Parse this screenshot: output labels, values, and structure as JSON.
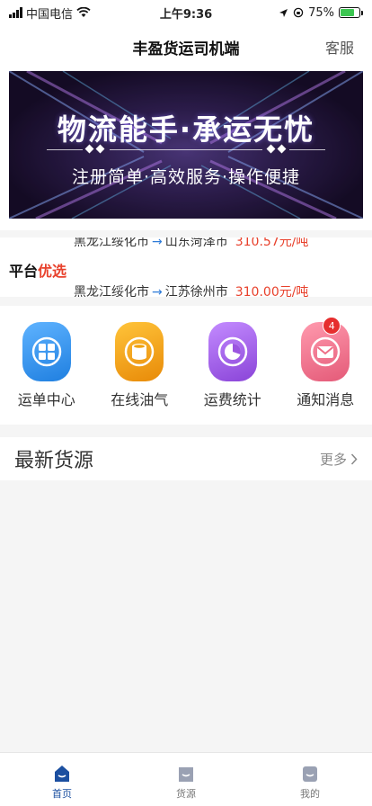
{
  "status_bar": {
    "carrier": "中国电信",
    "time": "上午9:36",
    "battery_percent": "75%",
    "battery_level": 0.75
  },
  "nav": {
    "title": "丰盈货运司机端",
    "service_label": "客服"
  },
  "banner": {
    "title": "物流能手·承运无忧",
    "subtitle": "注册简单·高效服务·操作便捷"
  },
  "ticker": {
    "brand_plain": "平台",
    "brand_highlight": "优选",
    "routes": [
      {
        "from": "黑龙江绥化市",
        "to": "山东菏泽市",
        "price": "310.57元/吨"
      },
      {
        "from": "黑龙江绥化市",
        "to": "江苏徐州市",
        "price": "310.00元/吨"
      }
    ]
  },
  "menu": {
    "items": [
      {
        "label": "运单中心",
        "icon": "grid-icon",
        "color": "#2b8be8"
      },
      {
        "label": "在线油气",
        "icon": "fuel-cylinder-icon",
        "color": "#f0a20c"
      },
      {
        "label": "运费统计",
        "icon": "pie-chart-icon",
        "color": "#9b55e0"
      },
      {
        "label": "通知消息",
        "icon": "mail-icon",
        "color": "#ee6e86",
        "badge": "4"
      }
    ]
  },
  "latest": {
    "title": "最新货源",
    "more_label": "更多"
  },
  "tabs": [
    {
      "label": "首页",
      "icon": "home-icon",
      "active": true
    },
    {
      "label": "货源",
      "icon": "cargo-icon",
      "active": false
    },
    {
      "label": "我的",
      "icon": "profile-icon",
      "active": false
    }
  ],
  "colors": {
    "accent_blue": "#1b4fa0",
    "price_red": "#e8412c",
    "badge_red": "#e62e2e"
  }
}
